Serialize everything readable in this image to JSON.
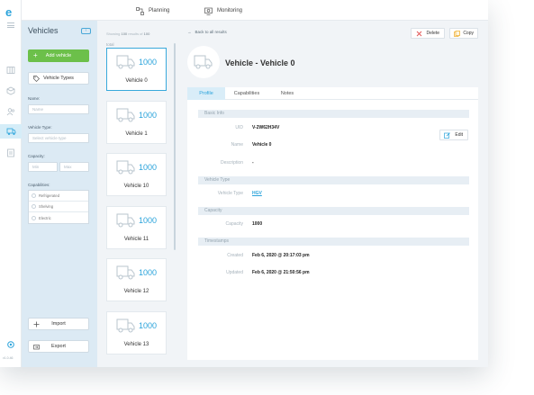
{
  "app": {
    "logo_letter": "e",
    "version": "v1.0.46"
  },
  "topnav": {
    "items": [
      {
        "label": "Planning",
        "icon": "route-icon"
      },
      {
        "label": "Monitoring",
        "icon": "monitor-icon"
      }
    ]
  },
  "sidebar": {
    "title": "Vehicles",
    "add_label": "Add vehicle",
    "types_label": "Vehicle Types",
    "name_label": "Name:",
    "name_placeholder": "Name",
    "type_label": "Vehicle Type:",
    "type_placeholder": "Select vehicle type",
    "capacity_label": "Capacity:",
    "min_placeholder": "Min",
    "max_placeholder": "Max",
    "capabilities_label": "Capabilities:",
    "capabilities": [
      "Refrigerated",
      "Shelving",
      "Electric"
    ],
    "import_label": "Import",
    "export_label": "Export"
  },
  "list": {
    "results_prefix": "Showing",
    "results_count": "100",
    "results_mid": "results of",
    "results_total": "100",
    "total_label": "total",
    "cards": [
      {
        "capacity": "1000",
        "name": "Vehicle 0",
        "selected": true
      },
      {
        "capacity": "1000",
        "name": "Vehicle 1"
      },
      {
        "capacity": "1000",
        "name": "Vehicle 10"
      },
      {
        "capacity": "1000",
        "name": "Vehicle 11"
      },
      {
        "capacity": "1000",
        "name": "Vehicle 12"
      },
      {
        "capacity": "1000",
        "name": "Vehicle 13"
      }
    ]
  },
  "detail": {
    "back_label": "Back to all results",
    "delete_label": "Delete",
    "copy_label": "Copy",
    "title": "Vehicle - Vehicle 0",
    "tabs": [
      "Profile",
      "Capabilities",
      "Notes"
    ],
    "edit_label": "Edit",
    "sections": {
      "basic": "Basic Info",
      "vehicle_type": "Vehicle Type",
      "capacity": "Capacity",
      "timestamps": "Timestamps"
    },
    "fields": {
      "uid_label": "UID",
      "uid_value": "V-2W62H34V",
      "name_label": "Name",
      "name_value": "Vehicle 0",
      "description_label": "Description",
      "description_value": "-",
      "type_label": "Vehicle Type",
      "type_value": "HGV",
      "capacity_label": "Capacity",
      "capacity_value": "1000",
      "created_label": "Created",
      "created_value": "Feb 6, 2020 @ 20:17:03 pm",
      "updated_label": "Updated",
      "updated_value": "Feb 6, 2020 @ 21:50:56 pm"
    }
  },
  "colors": {
    "accent": "#2aa3db",
    "green": "#6cc04a",
    "sidebar_bg": "#dceaf4",
    "selected_border": "#39a9db",
    "delete_red": "#e25a5a",
    "copy_yellow": "#f0b43c"
  }
}
